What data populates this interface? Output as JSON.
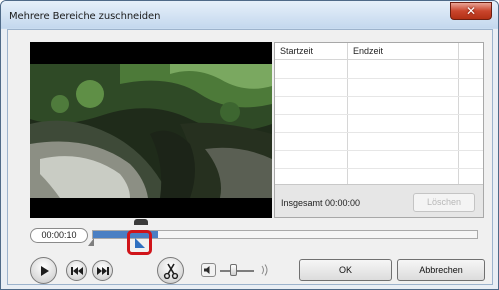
{
  "window": {
    "title": "Mehrere Bereiche zuschneiden"
  },
  "table": {
    "columns": [
      "Startzeit",
      "Endzeit"
    ],
    "rows": [],
    "total": "Insgesamt 00:00:00",
    "delete_label": "Löschen"
  },
  "timeline": {
    "current_time": "00:00:10",
    "progress": 0.17
  },
  "buttons": {
    "ok": "OK",
    "cancel": "Abbrechen"
  },
  "volume": {
    "level": 0.3
  },
  "colors": {
    "accent": "#4a7fc3",
    "highlight": "#d0141a"
  }
}
